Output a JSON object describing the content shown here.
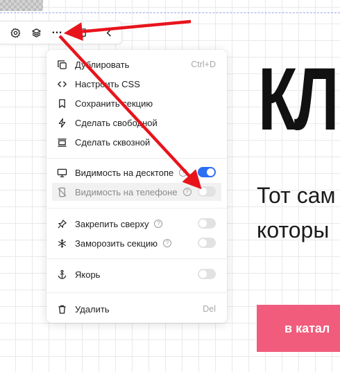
{
  "toolbar": {
    "buttons": [
      {
        "icon": "gear-icon"
      },
      {
        "icon": "layers-icon"
      },
      {
        "icon": "more-icon",
        "label": "…"
      },
      {
        "icon": "copy-icon"
      },
      {
        "icon": "chevron-left-icon"
      }
    ]
  },
  "canvas": {
    "title": "КЛ",
    "subtitle_line1": "Тот сам",
    "subtitle_line2": "которы",
    "cta_label": "в катал",
    "cta_color": "#f15c7c"
  },
  "menu": {
    "duplicate": {
      "label": "Дублировать",
      "shortcut": "Ctrl+D",
      "icon": "duplicate-icon"
    },
    "css": {
      "label": "Настроить CSS",
      "icon": "code-icon"
    },
    "save": {
      "label": "Сохранить секцию",
      "icon": "bookmark-icon"
    },
    "free": {
      "label": "Сделать свободной",
      "icon": "lightning-icon"
    },
    "through": {
      "label": "Сделать сквозной",
      "icon": "through-section-icon"
    },
    "desktop": {
      "label": "Видимость на десктопе",
      "icon": "desktop-icon",
      "enabled": true
    },
    "phone": {
      "label": "Видимость на телефоне",
      "icon": "phone-off-icon",
      "enabled": false
    },
    "pin": {
      "label": "Закрепить сверху",
      "icon": "pin-icon",
      "enabled": false
    },
    "freeze": {
      "label": "Заморозить секцию",
      "icon": "snowflake-icon",
      "enabled": false
    },
    "anchor": {
      "label": "Якорь",
      "icon": "anchor-icon",
      "enabled": false
    },
    "delete": {
      "label": "Удалить",
      "shortcut": "Del",
      "icon": "trash-icon"
    },
    "help_glyph": "?"
  },
  "colors": {
    "toggle_on": "#2b6ff3",
    "arrow": "#e8141c"
  }
}
